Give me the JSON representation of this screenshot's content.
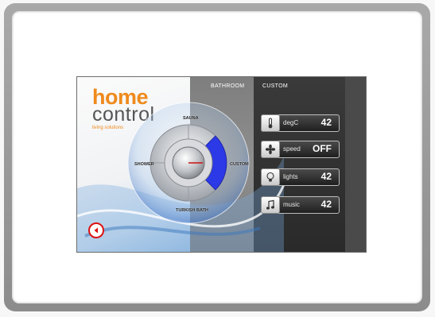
{
  "brand": {
    "word1": "home",
    "word2": "control",
    "tagline": "living solutions"
  },
  "header": {
    "section": "BATHROOM",
    "mode": "CUSTOM"
  },
  "dial": {
    "options": {
      "top": "SAUNA",
      "left": "SHOWER",
      "right": "CUSTOM",
      "bottom": "TURKISH BATH"
    },
    "selected": "CUSTOM"
  },
  "controls": [
    {
      "icon": "thermometer-icon",
      "label": "degC",
      "value": "42"
    },
    {
      "icon": "fan-icon",
      "label": "speed",
      "value": "OFF"
    },
    {
      "icon": "lightbulb-icon",
      "label": "lights",
      "value": "42"
    },
    {
      "icon": "music-note-icon",
      "label": "music",
      "value": "42"
    }
  ],
  "colors": {
    "brand_orange": "#ef8a1c",
    "selected_segment": "#2b39e6",
    "back_button": "#dd1111"
  }
}
